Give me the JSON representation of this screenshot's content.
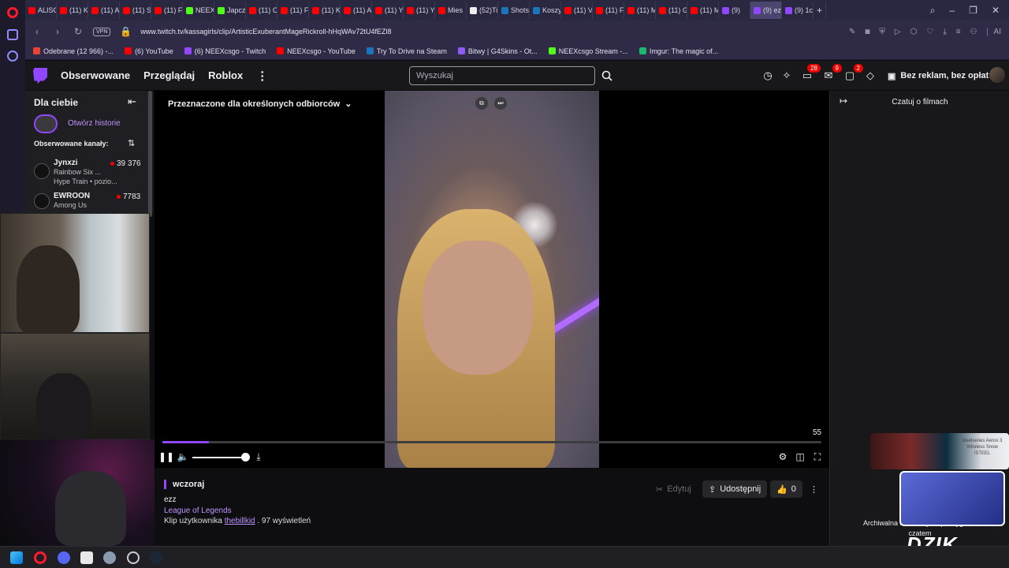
{
  "browser": {
    "tabs": [
      "ALISC",
      "(11) K",
      "(11) A",
      "(11) S",
      "(11) F",
      "NEEX",
      "Japcz",
      "(11) C",
      "(11) F",
      "(11) K",
      "(11) A",
      "(11) Y",
      "(11) Y",
      "Mies",
      "(52)Ti",
      "Shots",
      "Koszy",
      "(11) V",
      "(11) F",
      "(11) M",
      "(11) G",
      "(11) M",
      "(9)",
      "(9) ezz",
      "(9) 1c"
    ],
    "url": "www.twitch.tv/kassagirls/clip/ArtisticExuberantMageRickroll-hHqWAv72tU4fEZl8",
    "vpn_label": "VPN",
    "bookmarks": [
      {
        "label": "Odebrane (12 966) -...",
        "color": "#ea4335"
      },
      {
        "label": "(6) YouTube",
        "color": "#ff0000"
      },
      {
        "label": "(6) NEEXcsgo - Twitch",
        "color": "#9147ff"
      },
      {
        "label": "NEEXcsgo - YouTube",
        "color": "#ff0000"
      },
      {
        "label": "Try To Drive na Steam",
        "color": "#1b75bb"
      },
      {
        "label": "Bitwy | G4Skins - Ot...",
        "color": "#8b5cf6"
      },
      {
        "label": "NEEXcsgo Stream -...",
        "color": "#53fc18"
      },
      {
        "label": "Imgur: The magic of...",
        "color": "#1bb76e"
      }
    ],
    "ai_label": "AI"
  },
  "twitch": {
    "nav": {
      "following": "Obserwowane",
      "browse": "Przeglądaj",
      "roblox": "Roblox",
      "more": "⋮"
    },
    "search_placeholder": "Wyszukaj",
    "badges": {
      "inbox": "28",
      "notifications": "9",
      "whispers": "2"
    },
    "ad_free": "Bez reklam, bez opłat"
  },
  "sidebar": {
    "title": "Dla ciebie",
    "history": "Otwórz historie",
    "followed_title": "Obserwowane kanały:",
    "channels": [
      {
        "name": "Jynxzi",
        "game": "Rainbow Six ...",
        "viewers": "39 376",
        "hype": "Hype Train • pozio..."
      },
      {
        "name": "EWROON",
        "game": "Among Us",
        "viewers": "7783"
      }
    ]
  },
  "player": {
    "audience_label": "Przeznaczone dla określonych odbiorców",
    "counter": "55",
    "progress": 0.07,
    "volume": 0.95
  },
  "clip": {
    "date": "wczoraj",
    "title": "ezz",
    "game": "League of Legends",
    "by_prefix": "Klip użytkownika",
    "by_user": "thebillkid",
    "views": ". 97 wyświetleń",
    "edit": "Edytuj",
    "share": "Udostępnij",
    "likes": "0"
  },
  "chat": {
    "title": "Czatuj o filmach",
    "archive_line1": "Archiwalna transmisja klipu wygaś...",
    "archive_line2": "czatem"
  },
  "overlay": {
    "ad_text": "steelseries Aerox 3 Wireless Snow !STEEL",
    "brand": "DZIK"
  }
}
